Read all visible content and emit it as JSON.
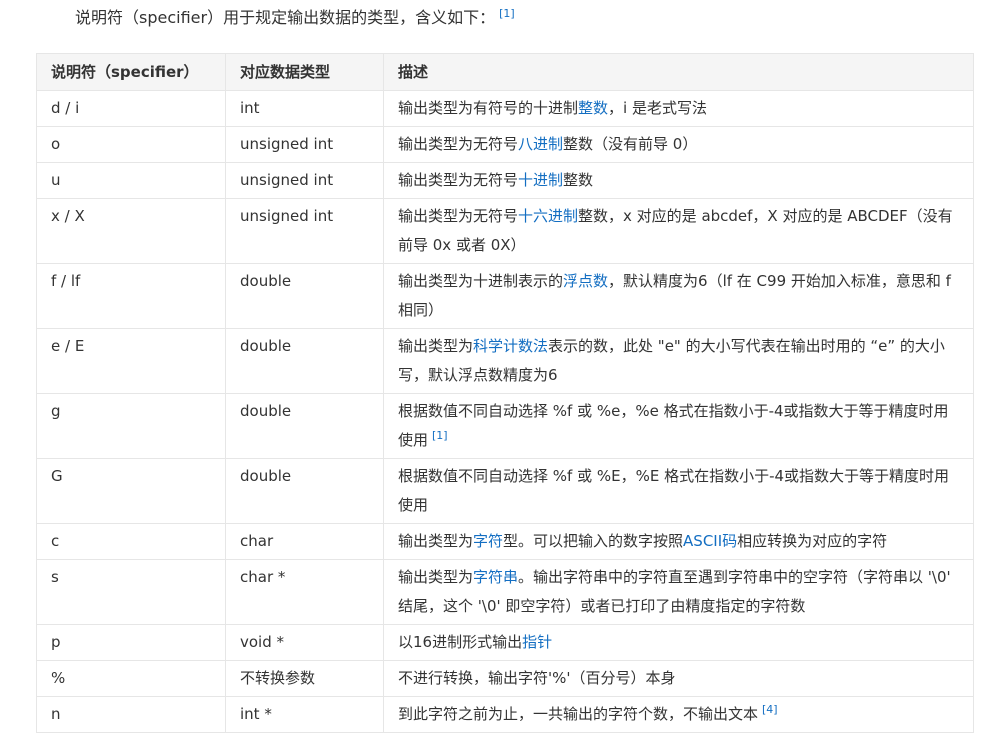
{
  "intro": {
    "text": "说明符（specifier）用于规定输出数据的类型，含义如下：",
    "ref": "[1]"
  },
  "table": {
    "headers": [
      "说明符（specifier）",
      "对应数据类型",
      "描述"
    ],
    "rows": [
      {
        "spec": "d / i",
        "type": "int",
        "desc": [
          {
            "t": "输出类型为有符号的十进制"
          },
          {
            "t": "整数",
            "link": true
          },
          {
            "t": "，i 是老式写法"
          }
        ]
      },
      {
        "spec": "o",
        "type": "unsigned int",
        "desc": [
          {
            "t": "输出类型为无符号"
          },
          {
            "t": "八进制",
            "link": true
          },
          {
            "t": "整数（没有前导 0）"
          }
        ]
      },
      {
        "spec": "u",
        "type": "unsigned int",
        "desc": [
          {
            "t": "输出类型为无符号"
          },
          {
            "t": "十进制",
            "link": true
          },
          {
            "t": "整数"
          }
        ]
      },
      {
        "spec": "x / X",
        "type": "unsigned int",
        "desc": [
          {
            "t": "输出类型为无符号"
          },
          {
            "t": "十六进制",
            "link": true
          },
          {
            "t": "整数，x 对应的是 abcdef，X 对应的是 ABCDEF（没有前导 0x 或者 0X）"
          }
        ]
      },
      {
        "spec": "f / lf",
        "type": "double",
        "desc": [
          {
            "t": "输出类型为十进制表示的"
          },
          {
            "t": "浮点数",
            "link": true
          },
          {
            "t": "，默认精度为6（lf 在 C99 开始加入标准，意思和 f 相同）"
          }
        ]
      },
      {
        "spec": "e / E",
        "type": "double",
        "desc": [
          {
            "t": "输出类型为"
          },
          {
            "t": "科学计数法",
            "link": true
          },
          {
            "t": "表示的数，此处 \"e\" 的大小写代表在输出时用的 “e” 的大小写，默认浮点数精度为6"
          }
        ]
      },
      {
        "spec": "g",
        "type": "double",
        "desc": [
          {
            "t": "根据数值不同自动选择 %f 或 %e，%e 格式在指数小于-4或指数大于等于精度时用使用"
          },
          {
            "t": "[1]",
            "ref": true
          }
        ]
      },
      {
        "spec": "G",
        "type": "double",
        "desc": [
          {
            "t": "根据数值不同自动选择 %f 或 %E，%E 格式在指数小于-4或指数大于等于精度时用使用"
          }
        ]
      },
      {
        "spec": "c",
        "type": "char",
        "desc": [
          {
            "t": "输出类型为"
          },
          {
            "t": "字符",
            "link": true
          },
          {
            "t": "型。可以把输入的数字按照"
          },
          {
            "t": "ASCII码",
            "link": true
          },
          {
            "t": "相应转换为对应的字符"
          }
        ]
      },
      {
        "spec": "s",
        "type": "char *",
        "desc": [
          {
            "t": "输出类型为"
          },
          {
            "t": "字符串",
            "link": true
          },
          {
            "t": "。输出字符串中的字符直至遇到字符串中的空字符（字符串以 '\\0' 结尾，这个 '\\0' 即空字符）或者已打印了由精度指定的字符数"
          }
        ]
      },
      {
        "spec": "p",
        "type": "void *",
        "desc": [
          {
            "t": "以16进制形式输出"
          },
          {
            "t": "指针",
            "link": true
          }
        ]
      },
      {
        "spec": "%",
        "type": "不转换参数",
        "desc": [
          {
            "t": "不进行转换，输出字符'%'（百分号）本身"
          }
        ]
      },
      {
        "spec": "n",
        "type": "int *",
        "desc": [
          {
            "t": "到此字符之前为止，一共输出的字符个数，不输出文本"
          },
          {
            "t": "[4]",
            "ref": true
          }
        ]
      }
    ]
  }
}
